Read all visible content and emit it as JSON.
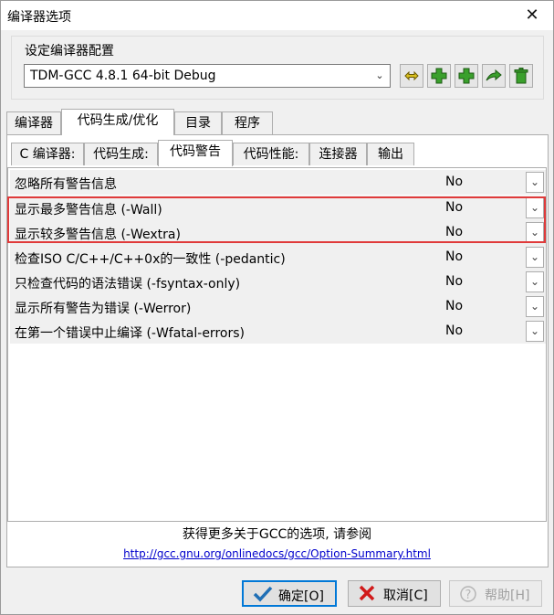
{
  "window": {
    "title": "编译器选项",
    "close_glyph": "✕"
  },
  "config": {
    "group_label": "设定编译器配置",
    "selected": "TDM-GCC 4.8.1 64-bit Debug",
    "toolbar": [
      {
        "name": "rename-icon"
      },
      {
        "name": "add-icon"
      },
      {
        "name": "add-copy-icon"
      },
      {
        "name": "export-icon"
      },
      {
        "name": "delete-icon"
      }
    ]
  },
  "tabs_main": [
    "编译器",
    "代码生成/优化",
    "目录",
    "程序"
  ],
  "tabs_sub": [
    "C 编译器:",
    "代码生成:",
    "代码警告",
    "代码性能:",
    "连接器",
    "输出"
  ],
  "options": [
    {
      "label": "忽略所有警告信息",
      "value": "No"
    },
    {
      "label": "显示最多警告信息 (-Wall)",
      "value": "No"
    },
    {
      "label": "显示较多警告信息 (-Wextra)",
      "value": "No"
    },
    {
      "label": "检查ISO C/C++/C++0x的一致性 (-pedantic)",
      "value": "No"
    },
    {
      "label": "只检查代码的语法错误 (-fsyntax-only)",
      "value": "No"
    },
    {
      "label": "显示所有警告为错误 (-Werror)",
      "value": "No"
    },
    {
      "label": "在第一个错误中止编译 (-Wfatal-errors)",
      "value": "No"
    }
  ],
  "more_info": "获得更多关于GCC的选项, 请参阅",
  "link": "http://gcc.gnu.org/onlinedocs/gcc/Option-Summary.html",
  "buttons": {
    "ok": "确定[O]",
    "cancel": "取消[C]",
    "help": "帮助[H]"
  },
  "colors": {
    "highlight": "#e03a3a",
    "link": "#0000cc",
    "icon_green": "#3aa02c"
  }
}
